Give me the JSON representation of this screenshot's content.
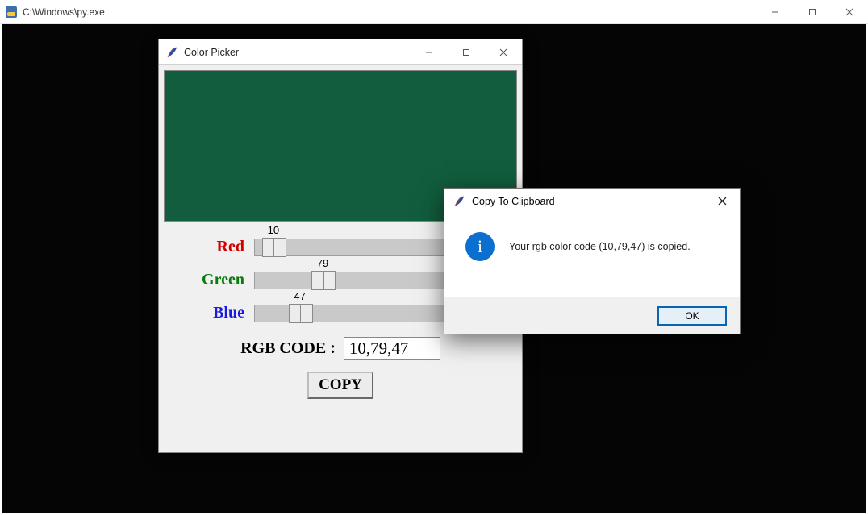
{
  "outer_window": {
    "title": "C:\\Windows\\py.exe"
  },
  "picker_window": {
    "title": "Color Picker",
    "swatch_color": "#115d3d",
    "sliders": {
      "red": {
        "label": "Red",
        "value": 10,
        "max": 255
      },
      "green": {
        "label": "Green",
        "value": 79,
        "max": 255
      },
      "blue": {
        "label": "Blue",
        "value": 47,
        "max": 255
      }
    },
    "rgb_label": "RGB CODE :",
    "rgb_value": "10,79,47",
    "copy_label": "COPY"
  },
  "msgbox": {
    "title": "Copy To Clipboard",
    "message": "Your rgb color code (10,79,47) is copied.",
    "ok_label": "OK"
  }
}
